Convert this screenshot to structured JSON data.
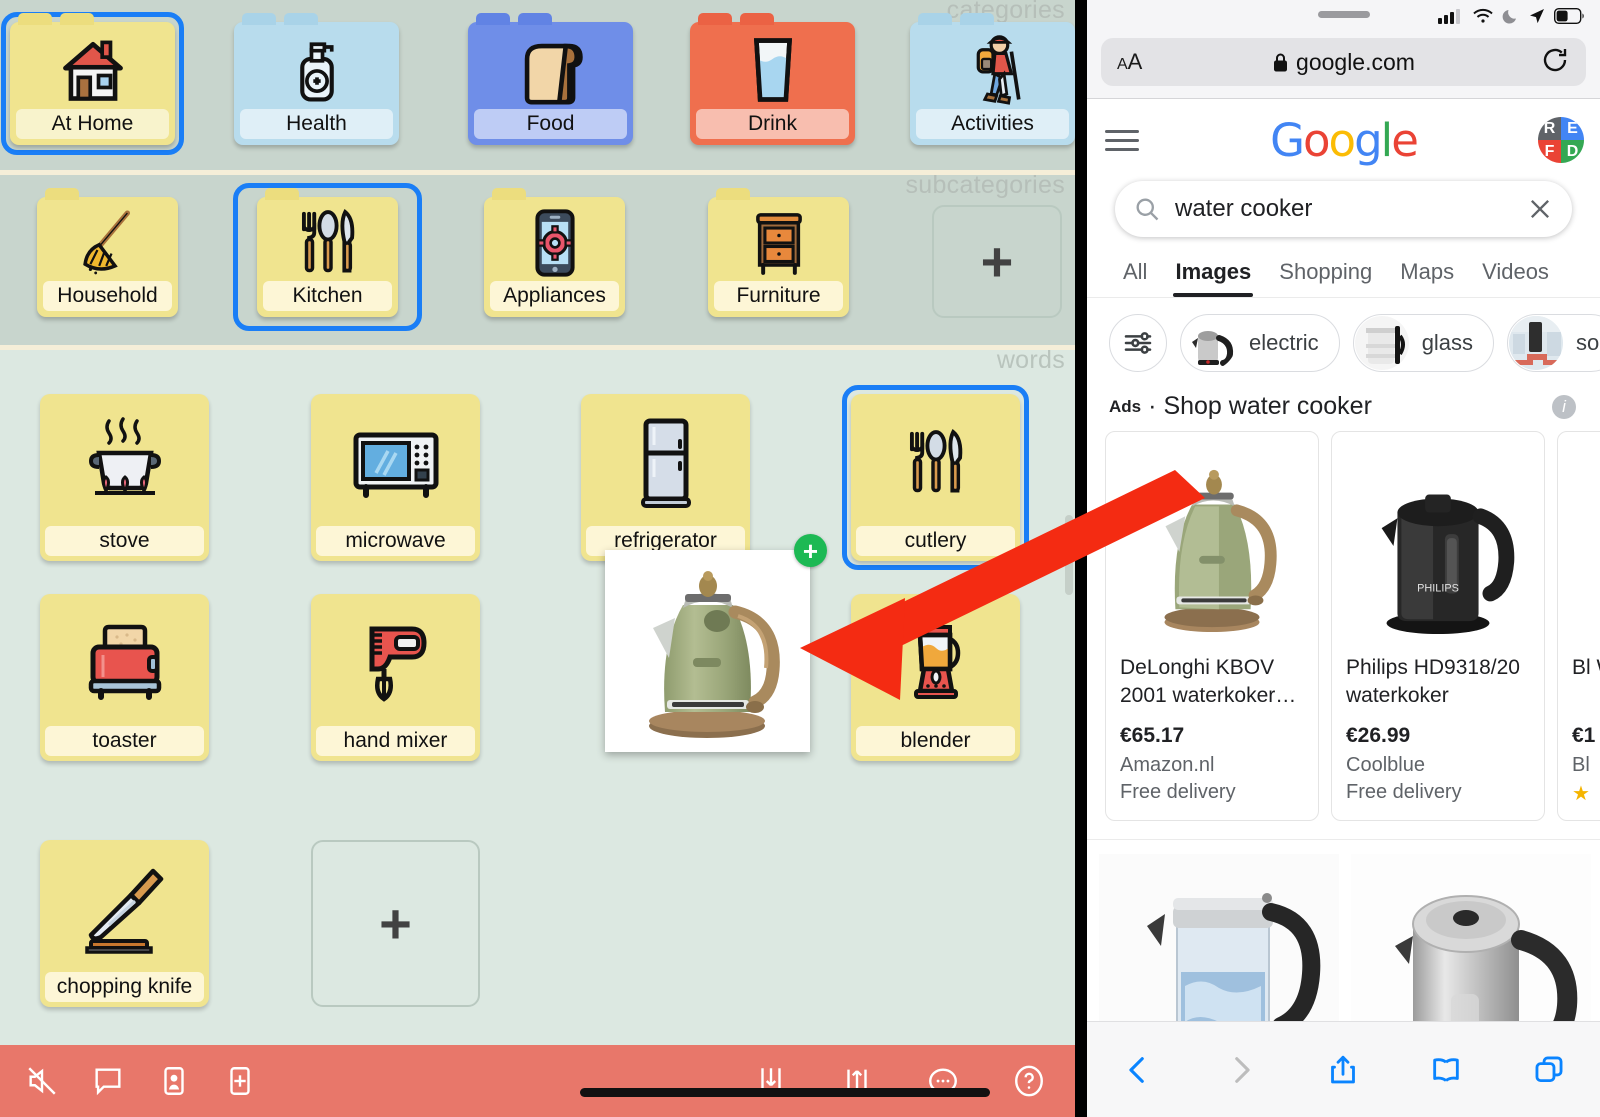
{
  "aac": {
    "sections": {
      "categories_label": "categories",
      "subcategories_label": "subcategories",
      "words_label": "words"
    },
    "categories": [
      {
        "label": "At Home",
        "icon": "house-icon",
        "color": "#f0e48f",
        "tab": "#ecdd7e",
        "selected": true
      },
      {
        "label": "Health",
        "icon": "soap-bottle-icon",
        "color": "#b8dced",
        "tab": "#a9d3e8",
        "selected": false
      },
      {
        "label": "Food",
        "icon": "bread-icon",
        "color": "#6f8ee8",
        "tab": "#6183e4",
        "selected": false
      },
      {
        "label": "Drink",
        "icon": "water-glass-icon",
        "color": "#ef6f4e",
        "tab": "#eb6244",
        "selected": false
      },
      {
        "label": "Activities",
        "icon": "hiker-icon",
        "color": "#b8dced",
        "tab": "#a9d3e8",
        "selected": false
      }
    ],
    "subcategories": [
      {
        "label": "Household",
        "icon": "broom-icon",
        "selected": false
      },
      {
        "label": "Kitchen",
        "icon": "cutlery-icon",
        "selected": true
      },
      {
        "label": "Appliances",
        "icon": "phone-gear-icon",
        "selected": false
      },
      {
        "label": "Furniture",
        "icon": "nightstand-icon",
        "selected": false
      }
    ],
    "subcategory_add_label": "+",
    "words": [
      {
        "label": "stove",
        "icon": "pot-on-stove-icon",
        "selected": false
      },
      {
        "label": "microwave",
        "icon": "microwave-icon",
        "selected": false
      },
      {
        "label": "refrigerator",
        "icon": "fridge-icon",
        "selected": false
      },
      {
        "label": "cutlery",
        "icon": "cutlery-icon",
        "selected": true
      },
      {
        "label": "toaster",
        "icon": "toaster-icon",
        "selected": false
      },
      {
        "label": "hand mixer",
        "icon": "hand-mixer-icon",
        "selected": false
      },
      {
        "label": "blender",
        "icon": "blender-icon",
        "selected": false
      },
      {
        "label": "chopping knife",
        "icon": "chef-knife-icon",
        "selected": false
      }
    ],
    "word_add_label": "+",
    "drag": {
      "name": "dragged-kettle-image",
      "badge": "+"
    },
    "toolbar": {
      "left_icons": [
        "mute-icon",
        "speech-bubble-icon",
        "user-card-icon",
        "add-card-icon"
      ],
      "right_icons": [
        "download-icon",
        "share-icon",
        "more-icon",
        "help-icon"
      ]
    },
    "colors": {
      "band": "#c8d5cd",
      "words_band": "#dce8e1",
      "divider": "#f5eed8",
      "card_yellow": "#f0e48f",
      "selection_blue": "#1a7ef6",
      "toolbar_red": "#e8776a",
      "add_green": "#1db954"
    }
  },
  "safari": {
    "status": {
      "icons": [
        "cell-signal-icon",
        "wifi-icon",
        "do-not-disturb-icon",
        "location-icon",
        "battery-icon"
      ],
      "battery_level": 50
    },
    "urlbar": {
      "text_size_label": "AA",
      "lock_icon": "lock-icon",
      "url": "google.com",
      "reload_icon": "reload-icon"
    },
    "google": {
      "menu_icon": "hamburger-menu-icon",
      "logo_text": "Google",
      "logo_letters": [
        {
          "ch": "G",
          "color": "#4285F4"
        },
        {
          "ch": "o",
          "color": "#EA4335"
        },
        {
          "ch": "o",
          "color": "#FBBC05"
        },
        {
          "ch": "g",
          "color": "#4285F4"
        },
        {
          "ch": "l",
          "color": "#34A853"
        },
        {
          "ch": "e",
          "color": "#EA4335"
        }
      ],
      "avatar": [
        {
          "ch": "R",
          "color": "#5f6368"
        },
        {
          "ch": "E",
          "color": "#4285F4"
        },
        {
          "ch": "F",
          "color": "#EA4335"
        },
        {
          "ch": "D",
          "color": "#34A853"
        }
      ],
      "search": {
        "query": "water cooker",
        "search_icon": "search-icon",
        "clear_icon": "clear-x-icon"
      },
      "tabs": [
        {
          "label": "All",
          "active": false
        },
        {
          "label": "Images",
          "active": true
        },
        {
          "label": "Shopping",
          "active": false
        },
        {
          "label": "Maps",
          "active": false
        },
        {
          "label": "Videos",
          "active": false
        }
      ],
      "chips": [
        {
          "label": "",
          "icon": "filter-sliders-icon",
          "type": "round"
        },
        {
          "label": "electric",
          "icon": "kettle-thumb-icon",
          "type": "image"
        },
        {
          "label": "glass",
          "icon": "glass-kettle-thumb-icon",
          "type": "image"
        },
        {
          "label": "so",
          "icon": "store-thumb-icon",
          "type": "image"
        }
      ],
      "ads": {
        "ads_label": "Ads",
        "separator": "·",
        "title": "Shop water cooker",
        "info_icon": "info-icon",
        "cards": [
          {
            "name": "DeLonghi KBOV 2001 waterkoker…",
            "price": "€65.17",
            "merchant": "Amazon.nl",
            "delivery": "Free delivery",
            "stars": "",
            "image": "green-delonghi-kettle"
          },
          {
            "name": "Philips HD9318/20 waterkoker",
            "price": "€26.99",
            "merchant": "Coolblue",
            "delivery": "Free delivery",
            "stars": "",
            "image": "black-philips-kettle"
          },
          {
            "name": "Bl W",
            "price": "€1",
            "merchant": "Bl",
            "delivery": "",
            "stars": "★",
            "image": "blue-glass-kettle"
          }
        ]
      },
      "image_results": [
        {
          "alt": "glass-kettle-with-water"
        },
        {
          "alt": "stainless-steel-kettle"
        }
      ]
    },
    "bottom_bar": {
      "icons": [
        "back-icon",
        "forward-icon",
        "share-icon",
        "bookmarks-icon",
        "tabs-icon"
      ],
      "back_enabled": true,
      "forward_enabled": false
    }
  }
}
